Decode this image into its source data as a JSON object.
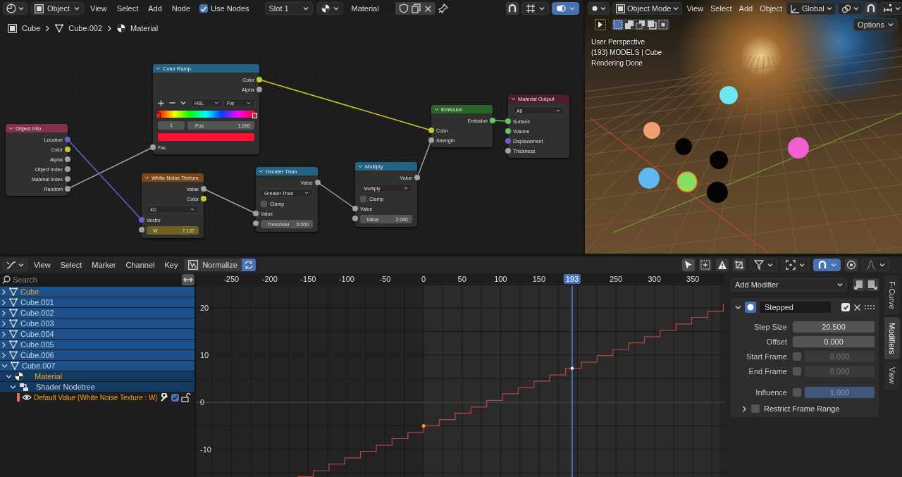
{
  "node_editor": {
    "header": {
      "object_mode": "Object",
      "menus": [
        "View",
        "Select",
        "Add",
        "Node"
      ],
      "use_nodes": {
        "label": "Use Nodes",
        "checked": true
      },
      "slot": "Slot 1",
      "material": "Material"
    },
    "breadcrumb": [
      "Cube",
      "Cube.002",
      "Material"
    ],
    "nodes": [
      {
        "title": "Object Info",
        "color": "#83314a",
        "rows": [
          {
            "kind": "output",
            "label": "Location",
            "color": "#6363c7"
          },
          {
            "kind": "output",
            "label": "Color",
            "color": "#c7c729"
          },
          {
            "kind": "output",
            "label": "Alpha",
            "color": "#a1a1a1"
          },
          {
            "kind": "output",
            "label": "Object Index",
            "color": "#a1a1a1"
          },
          {
            "kind": "output",
            "label": "Material Index",
            "color": "#a1a1a1"
          },
          {
            "kind": "output",
            "label": "Random",
            "color": "#a1a1a1"
          }
        ]
      },
      {
        "title": "Color Ramp",
        "color": "#246283",
        "rows": [
          {
            "kind": "output",
            "label": "Color",
            "color": "#c7c729"
          },
          {
            "kind": "output",
            "label": "Alpha",
            "color": "#a1a1a1"
          },
          {
            "kind": "ramp_tools",
            "color_mode": "HSL",
            "interpolation": "Far"
          },
          {
            "kind": "ramp",
            "stops": [
              {
                "level": 0,
                "selected": false
              },
              {
                "level": 1,
                "selected": true
              }
            ]
          },
          {
            "kind": "ramp_fields",
            "index": "1",
            "label": "Pos",
            "value": "1.000"
          },
          {
            "kind": "swatch",
            "color": "#ff1030"
          },
          {
            "kind": "input",
            "label": "Fac",
            "color": "#a1a1a1"
          }
        ]
      },
      {
        "title": "White Noise Texture",
        "color": "#7a461c",
        "rows": [
          {
            "kind": "output",
            "label": "Value",
            "color": "#a1a1a1"
          },
          {
            "kind": "output",
            "label": "Color",
            "color": "#c7c729"
          },
          {
            "kind": "dropdown",
            "value": "4D"
          },
          {
            "kind": "input",
            "label": "Vector",
            "color": "#6363c7"
          },
          {
            "kind": "field",
            "label": "W",
            "value": "7.137",
            "color": "#a1a1a1",
            "animated": true
          }
        ]
      },
      {
        "title": "Greater Than",
        "color": "#246283",
        "rows": [
          {
            "kind": "output",
            "label": "Value",
            "color": "#a1a1a1"
          },
          {
            "kind": "dropdown",
            "value": "Greater Than"
          },
          {
            "kind": "checkbox",
            "label": "Clamp",
            "checked": false
          },
          {
            "kind": "input",
            "label": "Value",
            "color": "#a1a1a1"
          },
          {
            "kind": "field",
            "label": "Threshold",
            "value": "0.500",
            "color": "#a1a1a1",
            "animated": false
          }
        ]
      },
      {
        "title": "Multiply",
        "color": "#246283",
        "rows": [
          {
            "kind": "output",
            "label": "Value",
            "color": "#a1a1a1"
          },
          {
            "kind": "dropdown",
            "value": "Multiply"
          },
          {
            "kind": "checkbox",
            "label": "Clamp",
            "checked": false
          },
          {
            "kind": "input",
            "label": "Value",
            "color": "#a1a1a1"
          },
          {
            "kind": "field",
            "label": "Value",
            "value": "2.000",
            "color": "#a1a1a1",
            "animated": false
          }
        ]
      },
      {
        "title": "Emission",
        "color": "#2b652b",
        "rows": [
          {
            "kind": "output",
            "label": "Emission",
            "color": "#63c763"
          },
          {
            "kind": "input",
            "label": "Color",
            "color": "#c7c729"
          },
          {
            "kind": "input",
            "label": "Strength",
            "color": "#a1a1a1"
          }
        ]
      },
      {
        "title": "Material Output",
        "color": "#4e1c26",
        "rows": [
          {
            "kind": "dropdown",
            "value": "All"
          },
          {
            "kind": "input",
            "label": "Surface",
            "color": "#63c763"
          },
          {
            "kind": "input",
            "label": "Volume",
            "color": "#63c763"
          },
          {
            "kind": "input",
            "label": "Displacement",
            "color": "#6363c7"
          },
          {
            "kind": "input",
            "label": "Thickness",
            "color": "#a1a1a1"
          }
        ]
      }
    ]
  },
  "viewport": {
    "header": {
      "mode": "Object Mode",
      "menus": [
        "View",
        "Select",
        "Add",
        "Object"
      ],
      "orientation": "Global",
      "options": "Options"
    },
    "overlay_lines": [
      "User Perspective",
      "(193) MODELS | Cube",
      "Rendering Done"
    ]
  },
  "graph_editor": {
    "header": {
      "menus": [
        "View",
        "Select",
        "Marker",
        "Channel",
        "Key"
      ],
      "normalize": {
        "label": "Normalize",
        "on": false
      },
      "sync": {
        "on": true
      }
    },
    "search": {
      "placeholder": "Search"
    },
    "channels": [
      {
        "kind": "object",
        "label": "Cube",
        "selected": true,
        "expanded": false
      },
      {
        "kind": "object",
        "label": "Cube.001",
        "selected": false,
        "expanded": false
      },
      {
        "kind": "object",
        "label": "Cube.002",
        "selected": false,
        "expanded": false
      },
      {
        "kind": "object",
        "label": "Cube.003",
        "selected": false,
        "expanded": false
      },
      {
        "kind": "object",
        "label": "Cube.004",
        "selected": false,
        "expanded": false
      },
      {
        "kind": "object",
        "label": "Cube.005",
        "selected": false,
        "expanded": false
      },
      {
        "kind": "object",
        "label": "Cube.006",
        "selected": false,
        "expanded": false
      },
      {
        "kind": "object",
        "label": "Cube.007",
        "selected": false,
        "expanded": true,
        "children": [
          {
            "kind": "material",
            "label": "Material",
            "selected": true,
            "expanded": true,
            "children": [
              {
                "kind": "nodetree",
                "label": "Shader Nodetree",
                "selected": false,
                "expanded": true,
                "children": [
                  {
                    "kind": "fcurve",
                    "label": "Default Value (White Noise Texture : W)",
                    "selected": true,
                    "color": "#e8675f",
                    "visible": true,
                    "enabled": true,
                    "locked": false
                  }
                ]
              }
            ]
          }
        ]
      }
    ],
    "chart_data": {
      "type": "line",
      "grid": true,
      "xlim": [
        -296,
        391
      ],
      "ylim": [
        -16,
        24.8
      ],
      "xticks": [
        -250,
        -200,
        -150,
        -100,
        -50,
        0,
        50,
        100,
        150,
        250,
        300,
        350
      ],
      "yticks": [
        -10,
        0,
        10,
        20
      ],
      "x": [
        -164,
        -143.5,
        -143.5,
        -123,
        -123,
        -102.5,
        -102.5,
        -82,
        -82,
        -61.5,
        -61.5,
        -41,
        -41,
        -20.5,
        -20.5,
        0,
        0,
        20.5,
        20.5,
        41,
        41,
        61.5,
        61.5,
        82,
        82,
        102.5,
        102.5,
        123,
        123,
        143.5,
        143.5,
        164,
        164,
        184.5,
        184.5,
        205,
        205,
        225.5,
        225.5,
        246,
        246,
        266.5,
        266.5,
        287,
        287,
        307.5,
        307.5,
        328,
        328,
        348.5,
        348.5,
        369,
        369,
        389.5,
        389.5,
        391
      ],
      "series": [
        {
          "color": "#b04848",
          "values": [
            -15.8,
            -15.8,
            -14.5,
            -14.5,
            -13.1,
            -13.1,
            -11.8,
            -11.8,
            -10.4,
            -10.4,
            -9.1,
            -9.1,
            -7.7,
            -7.7,
            -6.4,
            -6.4,
            -5,
            -5,
            -3.7,
            -3.7,
            -2.3,
            -2.3,
            -1,
            -1,
            0.4,
            0.4,
            1.8,
            1.8,
            3.1,
            3.1,
            4.5,
            4.5,
            5.8,
            5.8,
            7.2,
            7.2,
            8.5,
            8.5,
            9.9,
            9.9,
            11.2,
            11.2,
            12.6,
            12.6,
            13.9,
            13.9,
            15.3,
            15.3,
            16.6,
            16.6,
            18,
            18,
            19.3,
            19.3,
            20.7,
            20.7
          ]
        }
      ],
      "ref_lines": [
        {
          "axis": "x",
          "value": 193,
          "label": "193",
          "color": "#4772b3"
        }
      ]
    },
    "sidebar": {
      "add_modifier": "Add Modifier",
      "modifier": {
        "name": "Stepped",
        "expanded": true,
        "enabled": true,
        "fields": [
          {
            "kind": "number",
            "label": "Step Size",
            "value": "20.500"
          },
          {
            "kind": "number",
            "label": "Offset",
            "value": "0.000"
          },
          {
            "kind": "toggled_number",
            "label": "Start Frame",
            "checked": false,
            "value": "0.000"
          },
          {
            "kind": "toggled_number",
            "label": "End Frame",
            "checked": false,
            "value": "0.000"
          },
          {
            "kind": "toggled_slider",
            "label": "Influence",
            "checked": false,
            "value": "1.000",
            "level": 1
          }
        ],
        "restrict": {
          "label": "Restrict Frame Range",
          "expanded": false,
          "checked": false
        }
      },
      "tabs": [
        {
          "label": "F-Curve",
          "selected": false
        },
        {
          "label": "Modifiers",
          "selected": true
        },
        {
          "label": "View",
          "selected": false
        }
      ]
    }
  }
}
